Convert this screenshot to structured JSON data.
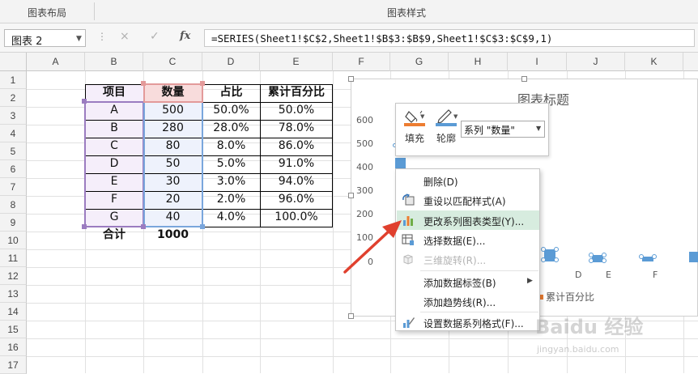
{
  "ribbon": {
    "groups": [
      {
        "label": "图表布局"
      },
      {
        "label": "图表样式"
      }
    ]
  },
  "formula_bar": {
    "name_box": "图表 2",
    "cancel_icon": "×",
    "enter_icon": "✓",
    "fx_label": "fx",
    "formula": "=SERIES(Sheet1!$C$2,Sheet1!$B$3:$B$9,Sheet1!$C$3:$C$9,1)"
  },
  "columns": [
    "A",
    "B",
    "C",
    "D",
    "E",
    "F",
    "G",
    "H",
    "I",
    "J",
    "K"
  ],
  "rows": [
    "1",
    "2",
    "3",
    "4",
    "5",
    "6",
    "7",
    "8",
    "9",
    "10",
    "11",
    "12",
    "13",
    "14",
    "15",
    "16",
    "17"
  ],
  "table": {
    "headers": [
      "项目",
      "数量",
      "占比",
      "累计百分比"
    ],
    "rows": [
      [
        "A",
        "500",
        "50.0%",
        "50.0%"
      ],
      [
        "B",
        "280",
        "28.0%",
        "78.0%"
      ],
      [
        "C",
        "80",
        "8.0%",
        "86.0%"
      ],
      [
        "D",
        "50",
        "5.0%",
        "91.0%"
      ],
      [
        "E",
        "30",
        "3.0%",
        "94.0%"
      ],
      [
        "F",
        "20",
        "2.0%",
        "96.0%"
      ],
      [
        "G",
        "40",
        "4.0%",
        "100.0%"
      ]
    ],
    "total_label": "合计",
    "total_value": "1000"
  },
  "chart": {
    "title": "图表标题",
    "y_ticks": [
      "600",
      "500",
      "400",
      "300",
      "200",
      "100",
      "0"
    ],
    "x_ticks_visible": [
      "D",
      "E",
      "F"
    ],
    "legend_visible_text": "累计百分比",
    "legend_color": "#ed7d31"
  },
  "mini_toolbar": {
    "fill_label": "填充",
    "outline_label": "轮廓",
    "series_selected": "系列 \"数量\""
  },
  "context_menu": {
    "items": [
      {
        "label": "删除(D)",
        "icon": "none"
      },
      {
        "label": "重设以匹配样式(A)",
        "icon": "reset-style-icon"
      },
      {
        "label": "更改系列图表类型(Y)...",
        "icon": "change-chart-type-icon",
        "highlighted": true
      },
      {
        "label": "选择数据(E)...",
        "icon": "select-data-icon"
      },
      {
        "label": "三维旋转(R)...",
        "icon": "3d-rotation-icon",
        "disabled": true
      },
      {
        "label": "添加数据标签(B)",
        "icon": "none",
        "submenu": true
      },
      {
        "label": "添加趋势线(R)...",
        "icon": "none"
      },
      {
        "label": "设置数据系列格式(F)...",
        "icon": "format-series-icon"
      }
    ]
  },
  "colors": {
    "excel_green": "#217346",
    "series_blue": "#5b9bd5",
    "menu_highlight": "#d7ecdf",
    "arrow_red": "#e0402e",
    "fill_orange": "#ed7d31"
  },
  "watermark": {
    "main": "Baidu 经验",
    "sub": "jingyan.baidu.com"
  }
}
